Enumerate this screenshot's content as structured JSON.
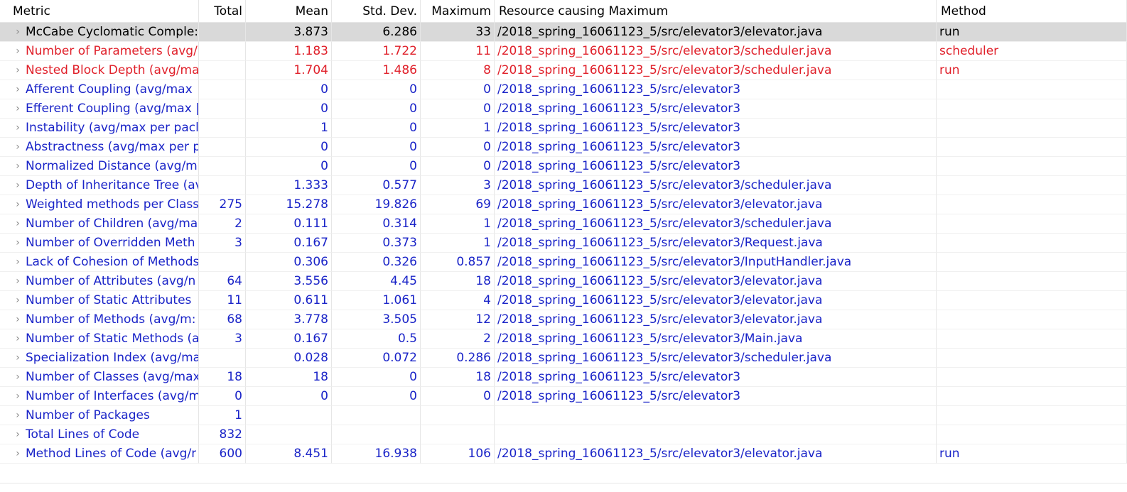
{
  "columns": {
    "metric": "Metric",
    "total": "Total",
    "mean": "Mean",
    "std": "Std. Dev.",
    "max": "Maximum",
    "resource": "Resource causing Maximum",
    "method": "Method"
  },
  "colors": {
    "warn": "#e0202a",
    "info": "#1a24c8",
    "selected_bg": "#d9d9d9"
  },
  "rows": [
    {
      "metric": "McCabe Cyclomatic Comple:",
      "total": "",
      "mean": "3.873",
      "std": "6.286",
      "max": "33",
      "resource": "/2018_spring_16061123_5/src/elevator3/elevator.java",
      "method": "run",
      "style": "selected"
    },
    {
      "metric": "Number of Parameters (avg/",
      "total": "",
      "mean": "1.183",
      "std": "1.722",
      "max": "11",
      "resource": "/2018_spring_16061123_5/src/elevator3/scheduler.java",
      "method": "scheduler",
      "style": "warn"
    },
    {
      "metric": "Nested Block Depth (avg/ma",
      "total": "",
      "mean": "1.704",
      "std": "1.486",
      "max": "8",
      "resource": "/2018_spring_16061123_5/src/elevator3/scheduler.java",
      "method": "run",
      "style": "warn"
    },
    {
      "metric": "Afferent Coupling (avg/max",
      "total": "",
      "mean": "0",
      "std": "0",
      "max": "0",
      "resource": "/2018_spring_16061123_5/src/elevator3",
      "method": "",
      "style": "info"
    },
    {
      "metric": "Efferent Coupling (avg/max |",
      "total": "",
      "mean": "0",
      "std": "0",
      "max": "0",
      "resource": "/2018_spring_16061123_5/src/elevator3",
      "method": "",
      "style": "info"
    },
    {
      "metric": "Instability (avg/max per pacl",
      "total": "",
      "mean": "1",
      "std": "0",
      "max": "1",
      "resource": "/2018_spring_16061123_5/src/elevator3",
      "method": "",
      "style": "info"
    },
    {
      "metric": "Abstractness (avg/max per p",
      "total": "",
      "mean": "0",
      "std": "0",
      "max": "0",
      "resource": "/2018_spring_16061123_5/src/elevator3",
      "method": "",
      "style": "info"
    },
    {
      "metric": "Normalized Distance (avg/m",
      "total": "",
      "mean": "0",
      "std": "0",
      "max": "0",
      "resource": "/2018_spring_16061123_5/src/elevator3",
      "method": "",
      "style": "info"
    },
    {
      "metric": "Depth of Inheritance Tree (av",
      "total": "",
      "mean": "1.333",
      "std": "0.577",
      "max": "3",
      "resource": "/2018_spring_16061123_5/src/elevator3/scheduler.java",
      "method": "",
      "style": "info"
    },
    {
      "metric": "Weighted methods per Class",
      "total": "275",
      "mean": "15.278",
      "std": "19.826",
      "max": "69",
      "resource": "/2018_spring_16061123_5/src/elevator3/elevator.java",
      "method": "",
      "style": "info"
    },
    {
      "metric": "Number of Children (avg/ma",
      "total": "2",
      "mean": "0.111",
      "std": "0.314",
      "max": "1",
      "resource": "/2018_spring_16061123_5/src/elevator3/scheduler.java",
      "method": "",
      "style": "info"
    },
    {
      "metric": "Number of Overridden Meth",
      "total": "3",
      "mean": "0.167",
      "std": "0.373",
      "max": "1",
      "resource": "/2018_spring_16061123_5/src/elevator3/Request.java",
      "method": "",
      "style": "info"
    },
    {
      "metric": "Lack of Cohesion of Methods",
      "total": "",
      "mean": "0.306",
      "std": "0.326",
      "max": "0.857",
      "resource": "/2018_spring_16061123_5/src/elevator3/InputHandler.java",
      "method": "",
      "style": "info"
    },
    {
      "metric": "Number of Attributes (avg/n",
      "total": "64",
      "mean": "3.556",
      "std": "4.45",
      "max": "18",
      "resource": "/2018_spring_16061123_5/src/elevator3/elevator.java",
      "method": "",
      "style": "info"
    },
    {
      "metric": "Number of Static Attributes",
      "total": "11",
      "mean": "0.611",
      "std": "1.061",
      "max": "4",
      "resource": "/2018_spring_16061123_5/src/elevator3/elevator.java",
      "method": "",
      "style": "info"
    },
    {
      "metric": "Number of Methods (avg/m:",
      "total": "68",
      "mean": "3.778",
      "std": "3.505",
      "max": "12",
      "resource": "/2018_spring_16061123_5/src/elevator3/elevator.java",
      "method": "",
      "style": "info"
    },
    {
      "metric": "Number of Static Methods (a",
      "total": "3",
      "mean": "0.167",
      "std": "0.5",
      "max": "2",
      "resource": "/2018_spring_16061123_5/src/elevator3/Main.java",
      "method": "",
      "style": "info"
    },
    {
      "metric": "Specialization Index (avg/ma",
      "total": "",
      "mean": "0.028",
      "std": "0.072",
      "max": "0.286",
      "resource": "/2018_spring_16061123_5/src/elevator3/scheduler.java",
      "method": "",
      "style": "info"
    },
    {
      "metric": "Number of Classes (avg/max",
      "total": "18",
      "mean": "18",
      "std": "0",
      "max": "18",
      "resource": "/2018_spring_16061123_5/src/elevator3",
      "method": "",
      "style": "info"
    },
    {
      "metric": "Number of Interfaces (avg/m",
      "total": "0",
      "mean": "0",
      "std": "0",
      "max": "0",
      "resource": "/2018_spring_16061123_5/src/elevator3",
      "method": "",
      "style": "info"
    },
    {
      "metric": "Number of Packages",
      "total": "1",
      "mean": "",
      "std": "",
      "max": "",
      "resource": "",
      "method": "",
      "style": "info"
    },
    {
      "metric": "Total Lines of Code",
      "total": "832",
      "mean": "",
      "std": "",
      "max": "",
      "resource": "",
      "method": "",
      "style": "info"
    },
    {
      "metric": "Method Lines of Code (avg/r",
      "total": "600",
      "mean": "8.451",
      "std": "16.938",
      "max": "106",
      "resource": "/2018_spring_16061123_5/src/elevator3/elevator.java",
      "method": "run",
      "style": "info"
    }
  ]
}
